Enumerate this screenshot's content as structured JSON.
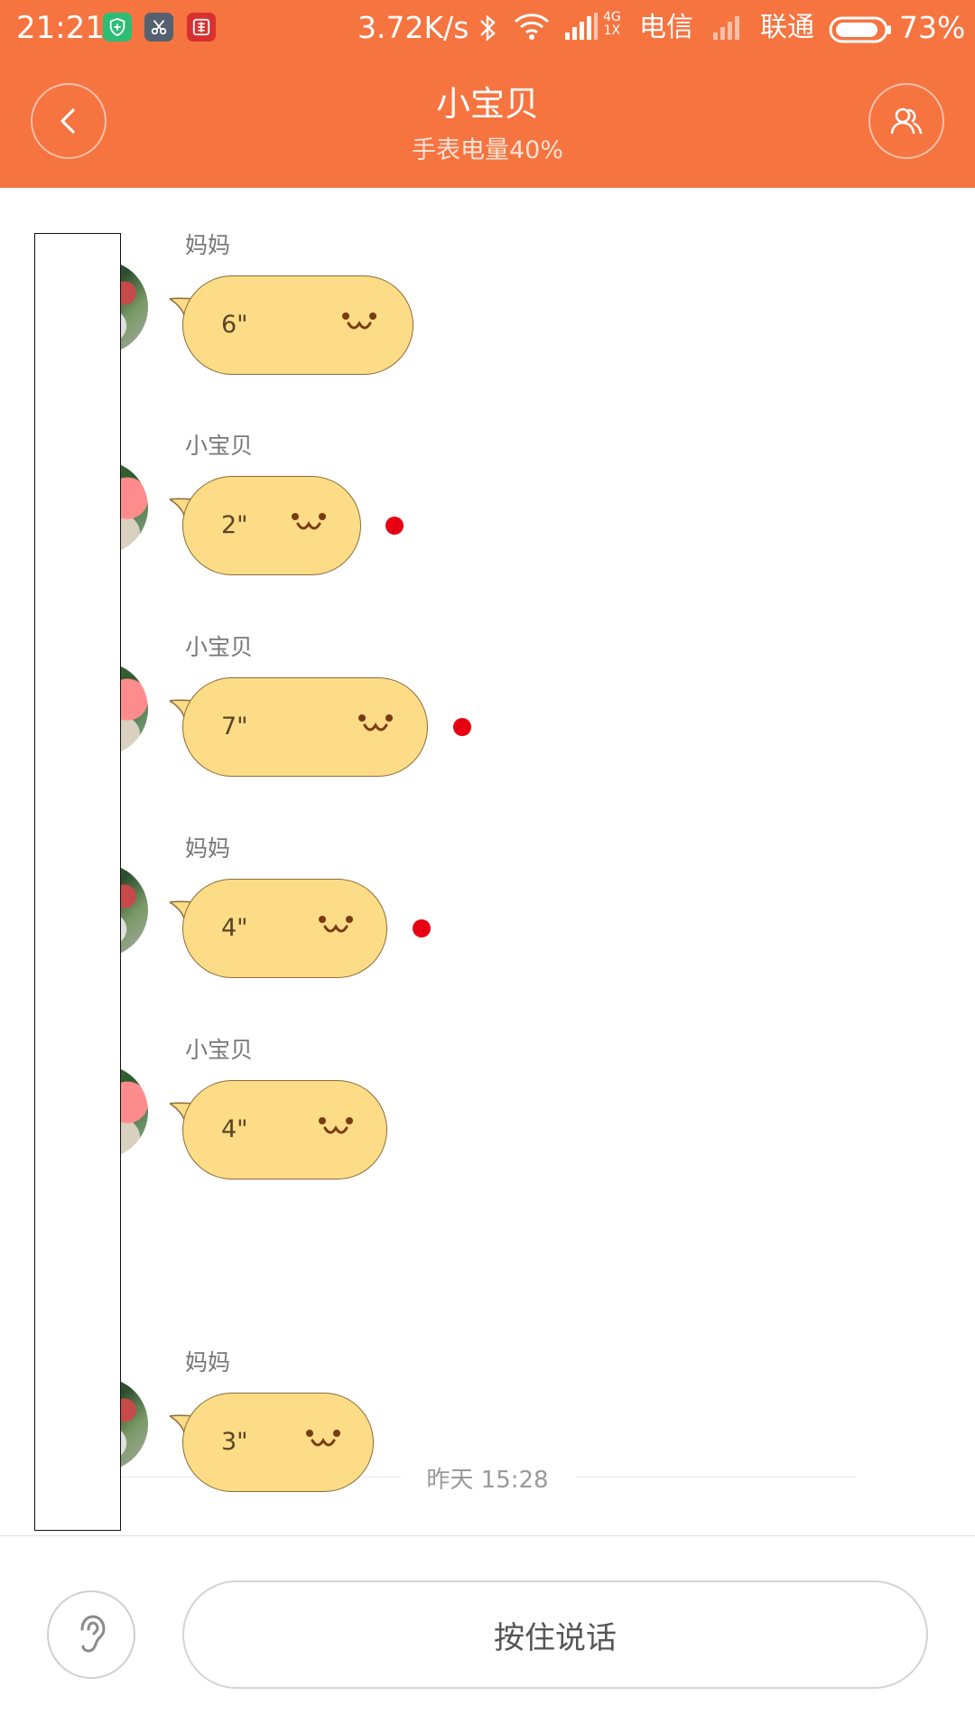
{
  "status_bar": {
    "time": "21:21",
    "net_speed": "3.72K/s",
    "network_tag_top": "4G",
    "network_tag_bottom": "1X",
    "carrier_1": "电信",
    "carrier_2": "联通",
    "battery": "73%",
    "notif_icons": [
      "shield-app-icon",
      "scissors-app-icon",
      "zhi-app-icon"
    ]
  },
  "header": {
    "title": "小宝贝",
    "subtitle": "手表电量40%"
  },
  "messages": [
    {
      "sender": "妈妈",
      "duration": "6\"",
      "unread": false
    },
    {
      "sender": "小宝贝",
      "duration": "2\"",
      "unread": true
    },
    {
      "sender": "小宝贝",
      "duration": "7\"",
      "unread": true
    },
    {
      "sender": "妈妈",
      "duration": "4\"",
      "unread": true
    },
    {
      "sender": "小宝贝",
      "duration": "4\"",
      "unread": false
    },
    {
      "sender": "妈妈",
      "duration": "3\"",
      "unread": false
    }
  ],
  "timestamp_divider": "昨天 15:28",
  "bottom": {
    "talk_label": "按住说话"
  },
  "colors": {
    "header": "#f67440",
    "bubble": "#fcdc86",
    "bubble_border": "#8e6b3a",
    "unread_dot": "#e60012"
  }
}
